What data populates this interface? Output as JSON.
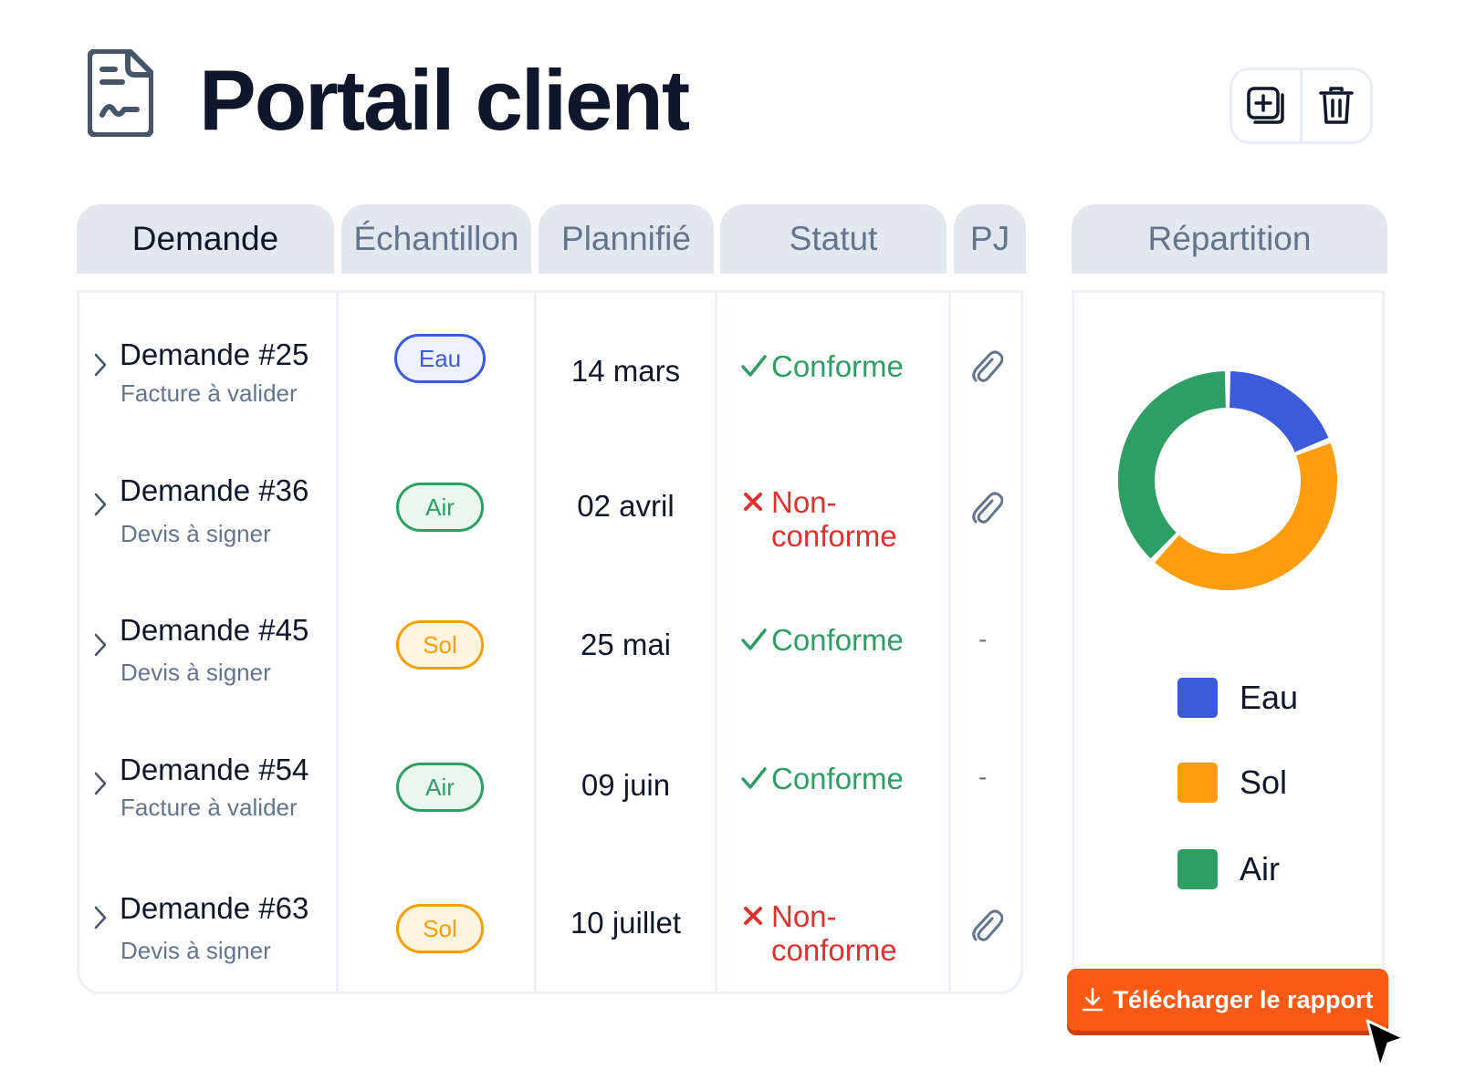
{
  "header": {
    "title": "Portail client",
    "icon": "document-signature-icon",
    "actions": [
      {
        "name": "duplicate",
        "icon": "copy-plus-icon"
      },
      {
        "name": "delete",
        "icon": "trash-icon"
      }
    ]
  },
  "table": {
    "columns": [
      "Demande",
      "Échantillon",
      "Plannifié",
      "Statut",
      "PJ"
    ],
    "rows": [
      {
        "title": "Demande #25",
        "subtitle": "Facture à valider",
        "sample": "Eau",
        "date": "14 mars",
        "status": "Conforme",
        "status_ok": true,
        "attachment": true
      },
      {
        "title": "Demande #36",
        "subtitle": "Devis à signer",
        "sample": "Air",
        "date": "02 avril",
        "status_line1": "Non-",
        "status_line2": "conforme",
        "status_ok": false,
        "attachment": true
      },
      {
        "title": "Demande #45",
        "subtitle": "Devis à signer",
        "sample": "Sol",
        "date": "25 mai",
        "status": "Conforme",
        "status_ok": true,
        "attachment": false,
        "attachment_text": "-"
      },
      {
        "title": "Demande #54",
        "subtitle": "Facture à valider",
        "sample": "Air",
        "date": "09 juin",
        "status": "Conforme",
        "status_ok": true,
        "attachment": false,
        "attachment_text": "-"
      },
      {
        "title": "Demande #63",
        "subtitle": "Devis à signer",
        "sample": "Sol",
        "date": "10 juillet",
        "status_line1": "Non-",
        "status_line2": "conforme",
        "status_ok": false,
        "attachment": true
      }
    ]
  },
  "repartition": {
    "header": "Répartition",
    "legend": [
      "Eau",
      "Sol",
      "Air"
    ],
    "colors": {
      "Eau": "#3b5bdb",
      "Sol": "#ff9c0f",
      "Air": "#2f9e64"
    }
  },
  "chart_data": {
    "type": "pie",
    "categories": [
      "Eau",
      "Sol",
      "Air"
    ],
    "values": [
      19,
      43,
      38
    ],
    "colors": [
      "#3b5bdb",
      "#ff9c0f",
      "#2f9e64"
    ]
  },
  "download_button": {
    "label": "Télécharger le rapport",
    "icon": "download-icon",
    "color": "#fa5a14"
  }
}
